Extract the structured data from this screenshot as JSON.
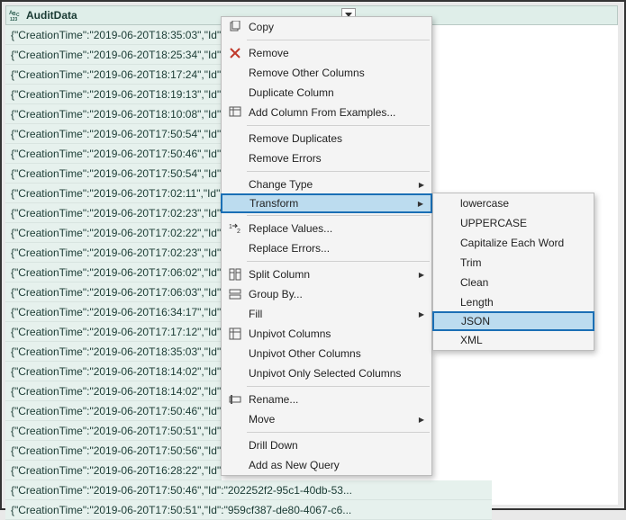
{
  "column": {
    "name": "AuditData",
    "type_icon": "ABC123",
    "rows": [
      "{\"CreationTime\":\"2019-06-20T18:35:03\",\"Id\":\"1c",
      "{\"CreationTime\":\"2019-06-20T18:25:34\",\"Id\":\"d0",
      "{\"CreationTime\":\"2019-06-20T18:17:24\",\"Id\":\"30",
      "{\"CreationTime\":\"2019-06-20T18:19:13\",\"Id\":\"be",
      "{\"CreationTime\":\"2019-06-20T18:10:08\",\"Id\":\"a5",
      "{\"CreationTime\":\"2019-06-20T17:50:54\",\"Id\":\"97",
      "{\"CreationTime\":\"2019-06-20T17:50:46\",\"Id\":\"1f8",
      "{\"CreationTime\":\"2019-06-20T17:50:54\",\"Id\":\"fd",
      "{\"CreationTime\":\"2019-06-20T17:02:11\",\"Id\":\"ed",
      "{\"CreationTime\":\"2019-06-20T17:02:23\",\"Id\":\"4a",
      "{\"CreationTime\":\"2019-06-20T17:02:22\",\"Id\":\"b3",
      "{\"CreationTime\":\"2019-06-20T17:02:23\",\"Id\":\"c0",
      "{\"CreationTime\":\"2019-06-20T17:06:02\",\"Id\":\"69",
      "{\"CreationTime\":\"2019-06-20T17:06:03\",\"Id\":\"fd",
      "{\"CreationTime\":\"2019-06-20T16:34:17\",\"Id\":\"fe",
      "{\"CreationTime\":\"2019-06-20T17:17:12\",\"Id\":\"ef",
      "{\"CreationTime\":\"2019-06-20T18:35:03\",\"Id\":\"1c",
      "{\"CreationTime\":\"2019-06-20T18:14:02\",\"Id\":\"94",
      "{\"CreationTime\":\"2019-06-20T18:14:02\",\"Id\":\"ee",
      "{\"CreationTime\":\"2019-06-20T17:50:46\",\"Id\":\"20",
      "{\"CreationTime\":\"2019-06-20T17:50:51\",\"Id\":\"95",
      "{\"CreationTime\":\"2019-06-20T17:50:56\",\"Id\":\"3c",
      "{\"CreationTime\":\"2019-06-20T16:28:22\",\"Id\":\"14",
      "{\"CreationTime\":\"2019-06-20T17:50:46\",\"Id\":\"202252f2-95c1-40db-53...",
      "{\"CreationTime\":\"2019-06-20T17:50:51\",\"Id\":\"959cf387-de80-4067-c6..."
    ]
  },
  "menu": {
    "groups": [
      [
        {
          "id": "copy",
          "label": "Copy",
          "icon": "copy"
        }
      ],
      [
        {
          "id": "remove",
          "label": "Remove",
          "icon": "remove"
        },
        {
          "id": "remove-other",
          "label": "Remove Other Columns"
        },
        {
          "id": "duplicate",
          "label": "Duplicate Column"
        },
        {
          "id": "add-col-examples",
          "label": "Add Column From Examples...",
          "icon": "table-add"
        }
      ],
      [
        {
          "id": "remove-dup",
          "label": "Remove Duplicates"
        },
        {
          "id": "remove-errors",
          "label": "Remove Errors"
        }
      ],
      [
        {
          "id": "change-type",
          "label": "Change Type",
          "submenu": true
        },
        {
          "id": "transform",
          "label": "Transform",
          "submenu": true,
          "highlight": true
        }
      ],
      [
        {
          "id": "replace-values",
          "label": "Replace Values...",
          "icon": "replace"
        },
        {
          "id": "replace-errors",
          "label": "Replace Errors..."
        }
      ],
      [
        {
          "id": "split-column",
          "label": "Split Column",
          "icon": "split",
          "submenu": true
        },
        {
          "id": "group-by",
          "label": "Group By...",
          "icon": "group"
        },
        {
          "id": "fill",
          "label": "Fill",
          "submenu": true
        },
        {
          "id": "unpivot",
          "label": "Unpivot Columns",
          "icon": "unpivot"
        },
        {
          "id": "unpivot-other",
          "label": "Unpivot Other Columns"
        },
        {
          "id": "unpivot-selected",
          "label": "Unpivot Only Selected Columns"
        }
      ],
      [
        {
          "id": "rename",
          "label": "Rename...",
          "icon": "rename"
        },
        {
          "id": "move",
          "label": "Move",
          "submenu": true
        }
      ],
      [
        {
          "id": "drill-down",
          "label": "Drill Down"
        },
        {
          "id": "add-new-query",
          "label": "Add as New Query"
        }
      ]
    ]
  },
  "submenu": {
    "items": [
      {
        "id": "lowercase",
        "label": "lowercase"
      },
      {
        "id": "uppercase",
        "label": "UPPERCASE"
      },
      {
        "id": "capitalize",
        "label": "Capitalize Each Word"
      },
      {
        "id": "trim",
        "label": "Trim"
      },
      {
        "id": "clean",
        "label": "Clean"
      },
      {
        "id": "length",
        "label": "Length"
      },
      {
        "id": "json",
        "label": "JSON",
        "highlight": true
      },
      {
        "id": "xml",
        "label": "XML"
      }
    ]
  }
}
